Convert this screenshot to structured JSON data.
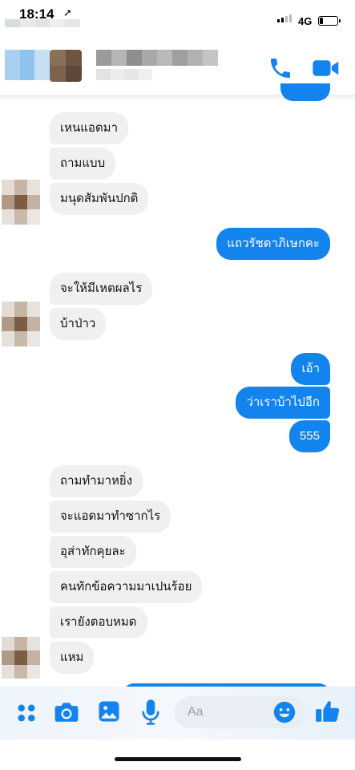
{
  "status_bar": {
    "time": "18:14",
    "network": "4G",
    "battery_level": 0.2
  },
  "colors": {
    "accent": "#1383ee",
    "incoming_bubble": "#f0f0f0",
    "outgoing_text": "#ffffff"
  },
  "header": {
    "call_icon": "phone-icon",
    "video_icon": "video-camera-icon"
  },
  "messages": [
    {
      "side": "in",
      "text": "เหนแอดมา"
    },
    {
      "side": "in",
      "text": "ถามแบบ"
    },
    {
      "side": "in",
      "text": "มนุดสัมพันปกติ"
    },
    {
      "side": "out",
      "text": "แถวรัชดาภิเษกคะ"
    },
    {
      "side": "in",
      "text": "จะให้มีเหตผลไร"
    },
    {
      "side": "in",
      "text": "บ้าป่าว"
    },
    {
      "side": "out",
      "text": "เอ้า"
    },
    {
      "side": "out",
      "text": "ว่าเราบ้าไปอีก"
    },
    {
      "side": "out",
      "text": "555"
    },
    {
      "side": "in",
      "text": "ถามทำมาหยิ่ง"
    },
    {
      "side": "in",
      "text": "จะแอดมาทำซากไร"
    },
    {
      "side": "in",
      "text": "อุส่าทักคุยละ"
    },
    {
      "side": "in",
      "text": "คนทักข้อความมาเปนร้อย"
    },
    {
      "side": "in",
      "text": "เรายังตอบหมด"
    },
    {
      "side": "in",
      "text": "แหม"
    }
  ],
  "composer": {
    "placeholder": "Aa",
    "icons": [
      "apps-icon",
      "camera-icon",
      "gallery-icon",
      "microphone-icon",
      "emoji-icon",
      "thumbs-up-icon"
    ]
  }
}
